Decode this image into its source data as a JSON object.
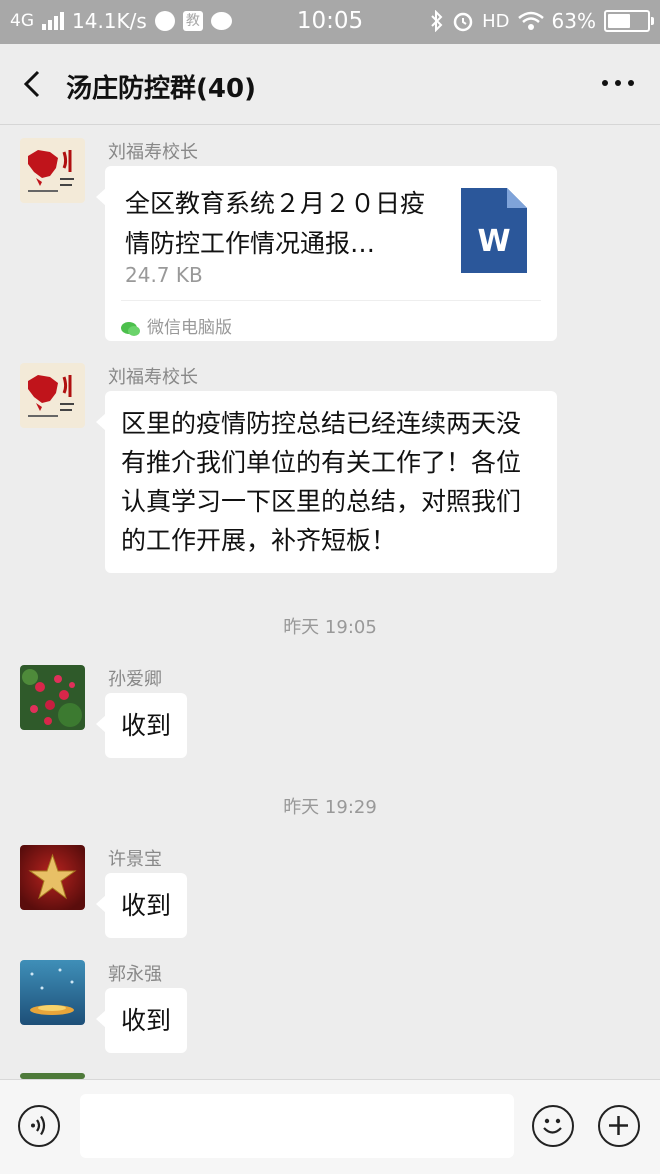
{
  "status_bar": {
    "network": "4G",
    "speed": "14.1K/s",
    "notif_app_label": "教",
    "time": "10:05",
    "hd": "HD",
    "battery": "63%",
    "battery_level": 0.63
  },
  "header": {
    "title": "汤庄防控群(40)"
  },
  "messages": [
    {
      "sender": "刘福寿校长",
      "type": "file",
      "file_title": "全区教育系统２月２０日疫情防控工作情况通报…",
      "file_size": "24.7 KB",
      "file_type_letter": "W",
      "source": "微信电脑版"
    },
    {
      "sender": "刘福寿校长",
      "type": "text",
      "text": "区里的疫情防控总结已经连续两天没有推介我们单位的有关工作了！各位认真学习一下区里的总结，对照我们的工作开展，补齐短板！"
    },
    {
      "type": "time",
      "text": "昨天 19:05"
    },
    {
      "sender": "孙爱卿",
      "type": "text",
      "text": "收到"
    },
    {
      "type": "time",
      "text": "昨天 19:29"
    },
    {
      "sender": "许景宝",
      "type": "text",
      "text": "收到"
    },
    {
      "sender": "郭永强",
      "type": "text",
      "text": "收到"
    }
  ],
  "colors": {
    "status_bar_bg": "#a8a8a8",
    "chat_bg": "#ededed",
    "bubble_bg": "#ffffff",
    "word_icon": "#2b579a"
  }
}
